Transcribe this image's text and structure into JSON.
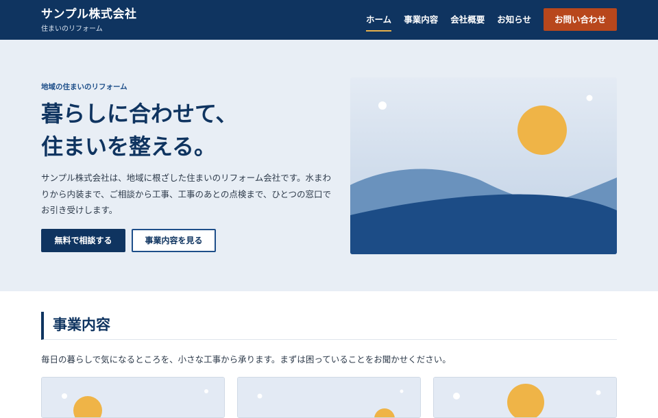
{
  "header": {
    "brand_name": "サンプル株式会社",
    "brand_tagline": "住まいのリフォーム",
    "nav": [
      {
        "label": "ホーム",
        "active": true
      },
      {
        "label": "事業内容",
        "active": false
      },
      {
        "label": "会社概要",
        "active": false
      },
      {
        "label": "お知らせ",
        "active": false
      }
    ],
    "cta_label": "お問い合わせ"
  },
  "hero": {
    "eyebrow": "地域の住まいのリフォーム",
    "title_line1": "暮らしに合わせて、",
    "title_line2": "住まいを整える。",
    "text": "サンプル株式会社は、地域に根ざした住まいのリフォーム会社です。水まわりから内装まで、ご相談から工事、工事のあとの点検まで、ひとつの窓口でお引き受けします。",
    "primary_button": "無料で相談する",
    "secondary_button": "事業内容を見る"
  },
  "services": {
    "title": "事業内容",
    "lead": "毎日の暮らしで気になるところを、小さな工事から承ります。まずは困っていることをお聞かせください。"
  },
  "colors": {
    "navy": "#0f3460",
    "accent": "#b8471c",
    "sun": "#efb447",
    "hero_bg": "#e8eef5"
  }
}
